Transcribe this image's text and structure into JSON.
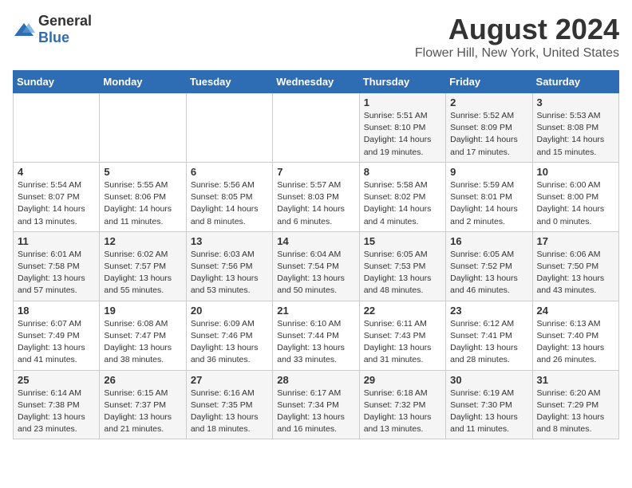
{
  "logo": {
    "general": "General",
    "blue": "Blue"
  },
  "title": "August 2024",
  "subtitle": "Flower Hill, New York, United States",
  "days_of_week": [
    "Sunday",
    "Monday",
    "Tuesday",
    "Wednesday",
    "Thursday",
    "Friday",
    "Saturday"
  ],
  "weeks": [
    [
      {
        "day": "",
        "info": ""
      },
      {
        "day": "",
        "info": ""
      },
      {
        "day": "",
        "info": ""
      },
      {
        "day": "",
        "info": ""
      },
      {
        "day": "1",
        "info": "Sunrise: 5:51 AM\nSunset: 8:10 PM\nDaylight: 14 hours\nand 19 minutes."
      },
      {
        "day": "2",
        "info": "Sunrise: 5:52 AM\nSunset: 8:09 PM\nDaylight: 14 hours\nand 17 minutes."
      },
      {
        "day": "3",
        "info": "Sunrise: 5:53 AM\nSunset: 8:08 PM\nDaylight: 14 hours\nand 15 minutes."
      }
    ],
    [
      {
        "day": "4",
        "info": "Sunrise: 5:54 AM\nSunset: 8:07 PM\nDaylight: 14 hours\nand 13 minutes."
      },
      {
        "day": "5",
        "info": "Sunrise: 5:55 AM\nSunset: 8:06 PM\nDaylight: 14 hours\nand 11 minutes."
      },
      {
        "day": "6",
        "info": "Sunrise: 5:56 AM\nSunset: 8:05 PM\nDaylight: 14 hours\nand 8 minutes."
      },
      {
        "day": "7",
        "info": "Sunrise: 5:57 AM\nSunset: 8:03 PM\nDaylight: 14 hours\nand 6 minutes."
      },
      {
        "day": "8",
        "info": "Sunrise: 5:58 AM\nSunset: 8:02 PM\nDaylight: 14 hours\nand 4 minutes."
      },
      {
        "day": "9",
        "info": "Sunrise: 5:59 AM\nSunset: 8:01 PM\nDaylight: 14 hours\nand 2 minutes."
      },
      {
        "day": "10",
        "info": "Sunrise: 6:00 AM\nSunset: 8:00 PM\nDaylight: 14 hours\nand 0 minutes."
      }
    ],
    [
      {
        "day": "11",
        "info": "Sunrise: 6:01 AM\nSunset: 7:58 PM\nDaylight: 13 hours\nand 57 minutes."
      },
      {
        "day": "12",
        "info": "Sunrise: 6:02 AM\nSunset: 7:57 PM\nDaylight: 13 hours\nand 55 minutes."
      },
      {
        "day": "13",
        "info": "Sunrise: 6:03 AM\nSunset: 7:56 PM\nDaylight: 13 hours\nand 53 minutes."
      },
      {
        "day": "14",
        "info": "Sunrise: 6:04 AM\nSunset: 7:54 PM\nDaylight: 13 hours\nand 50 minutes."
      },
      {
        "day": "15",
        "info": "Sunrise: 6:05 AM\nSunset: 7:53 PM\nDaylight: 13 hours\nand 48 minutes."
      },
      {
        "day": "16",
        "info": "Sunrise: 6:05 AM\nSunset: 7:52 PM\nDaylight: 13 hours\nand 46 minutes."
      },
      {
        "day": "17",
        "info": "Sunrise: 6:06 AM\nSunset: 7:50 PM\nDaylight: 13 hours\nand 43 minutes."
      }
    ],
    [
      {
        "day": "18",
        "info": "Sunrise: 6:07 AM\nSunset: 7:49 PM\nDaylight: 13 hours\nand 41 minutes."
      },
      {
        "day": "19",
        "info": "Sunrise: 6:08 AM\nSunset: 7:47 PM\nDaylight: 13 hours\nand 38 minutes."
      },
      {
        "day": "20",
        "info": "Sunrise: 6:09 AM\nSunset: 7:46 PM\nDaylight: 13 hours\nand 36 minutes."
      },
      {
        "day": "21",
        "info": "Sunrise: 6:10 AM\nSunset: 7:44 PM\nDaylight: 13 hours\nand 33 minutes."
      },
      {
        "day": "22",
        "info": "Sunrise: 6:11 AM\nSunset: 7:43 PM\nDaylight: 13 hours\nand 31 minutes."
      },
      {
        "day": "23",
        "info": "Sunrise: 6:12 AM\nSunset: 7:41 PM\nDaylight: 13 hours\nand 28 minutes."
      },
      {
        "day": "24",
        "info": "Sunrise: 6:13 AM\nSunset: 7:40 PM\nDaylight: 13 hours\nand 26 minutes."
      }
    ],
    [
      {
        "day": "25",
        "info": "Sunrise: 6:14 AM\nSunset: 7:38 PM\nDaylight: 13 hours\nand 23 minutes."
      },
      {
        "day": "26",
        "info": "Sunrise: 6:15 AM\nSunset: 7:37 PM\nDaylight: 13 hours\nand 21 minutes."
      },
      {
        "day": "27",
        "info": "Sunrise: 6:16 AM\nSunset: 7:35 PM\nDaylight: 13 hours\nand 18 minutes."
      },
      {
        "day": "28",
        "info": "Sunrise: 6:17 AM\nSunset: 7:34 PM\nDaylight: 13 hours\nand 16 minutes."
      },
      {
        "day": "29",
        "info": "Sunrise: 6:18 AM\nSunset: 7:32 PM\nDaylight: 13 hours\nand 13 minutes."
      },
      {
        "day": "30",
        "info": "Sunrise: 6:19 AM\nSunset: 7:30 PM\nDaylight: 13 hours\nand 11 minutes."
      },
      {
        "day": "31",
        "info": "Sunrise: 6:20 AM\nSunset: 7:29 PM\nDaylight: 13 hours\nand 8 minutes."
      }
    ]
  ]
}
